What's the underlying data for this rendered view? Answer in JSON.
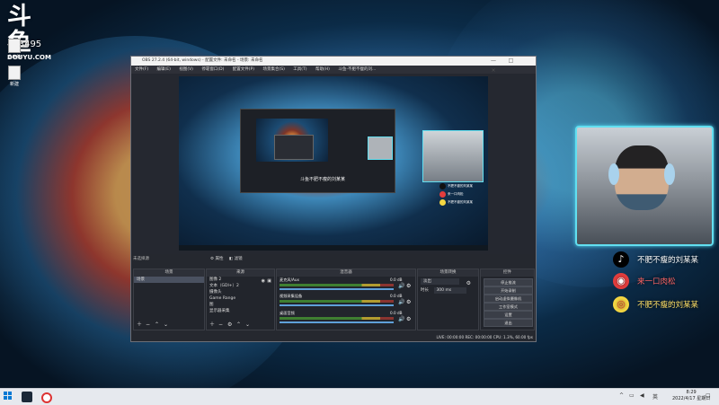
{
  "overlay": {
    "brand": "斗鱼",
    "site": "DOUYU.COM",
    "room_id": "433495"
  },
  "desktop_icons": [
    {
      "label": "此电脑"
    },
    {
      "label": "新建"
    }
  ],
  "social": [
    {
      "platform": "tiktok-icon",
      "text": "不肥不瘦的刘某某"
    },
    {
      "platform": "douyu-fish-icon",
      "text": "来一口肉松"
    },
    {
      "platform": "weibo-icon",
      "text": "不肥不瘦的刘某某"
    }
  ],
  "obs": {
    "title": "OBS 27.2.4 (64-bit, windows) - 配置文件: 未命名 - 场景: 未命名",
    "menu": [
      "文件(F)",
      "编辑(E)",
      "视图(V)",
      "停靠窗口(D)",
      "配置文件(P)",
      "场景集合(S)",
      "工具(T)",
      "帮助(H)",
      "斗鱼-不肥不瘦的刘..."
    ],
    "preview_text": "斗鱼不肥不瘦的刘某某",
    "scene_label": "未选择源",
    "mixer_tabs": [
      "属性",
      "滤镜"
    ],
    "docks": {
      "scenes": "场景",
      "sources": "来源",
      "mixer": "混音器",
      "transitions": "场景转换",
      "controls": "控件"
    },
    "scene_items": [
      "场景"
    ],
    "source_items": [
      "图像 2",
      "文本（GDI+）2",
      "摄像头",
      "Game Range",
      "图",
      "显示器采集"
    ],
    "mixer_rows": [
      {
        "name": "麦克风/Aux",
        "db": "0.0 dB"
      },
      {
        "name": "视频采集设备",
        "db": "0.0 dB"
      },
      {
        "name": "桌面音频",
        "db": "0.0 dB"
      }
    ],
    "transition": {
      "mode": "淡出",
      "duration_label": "时长",
      "duration": "300 ms"
    },
    "controls": [
      "停止推流",
      "开始录制",
      "启动虚拟摄像机",
      "工作室模式",
      "设置",
      "退出"
    ],
    "status": "LIVE: 00:00:00  REC: 00:00:00  CPU: 1.3%, 60.00 fps"
  },
  "taskbar": {
    "time": "8:29",
    "date": "2022/4/17 星期日",
    "tray_text": "英"
  },
  "colors": {
    "accent": "#62dff0",
    "obs_bg": "#25282f",
    "taskbar": "#e6e9ee"
  }
}
